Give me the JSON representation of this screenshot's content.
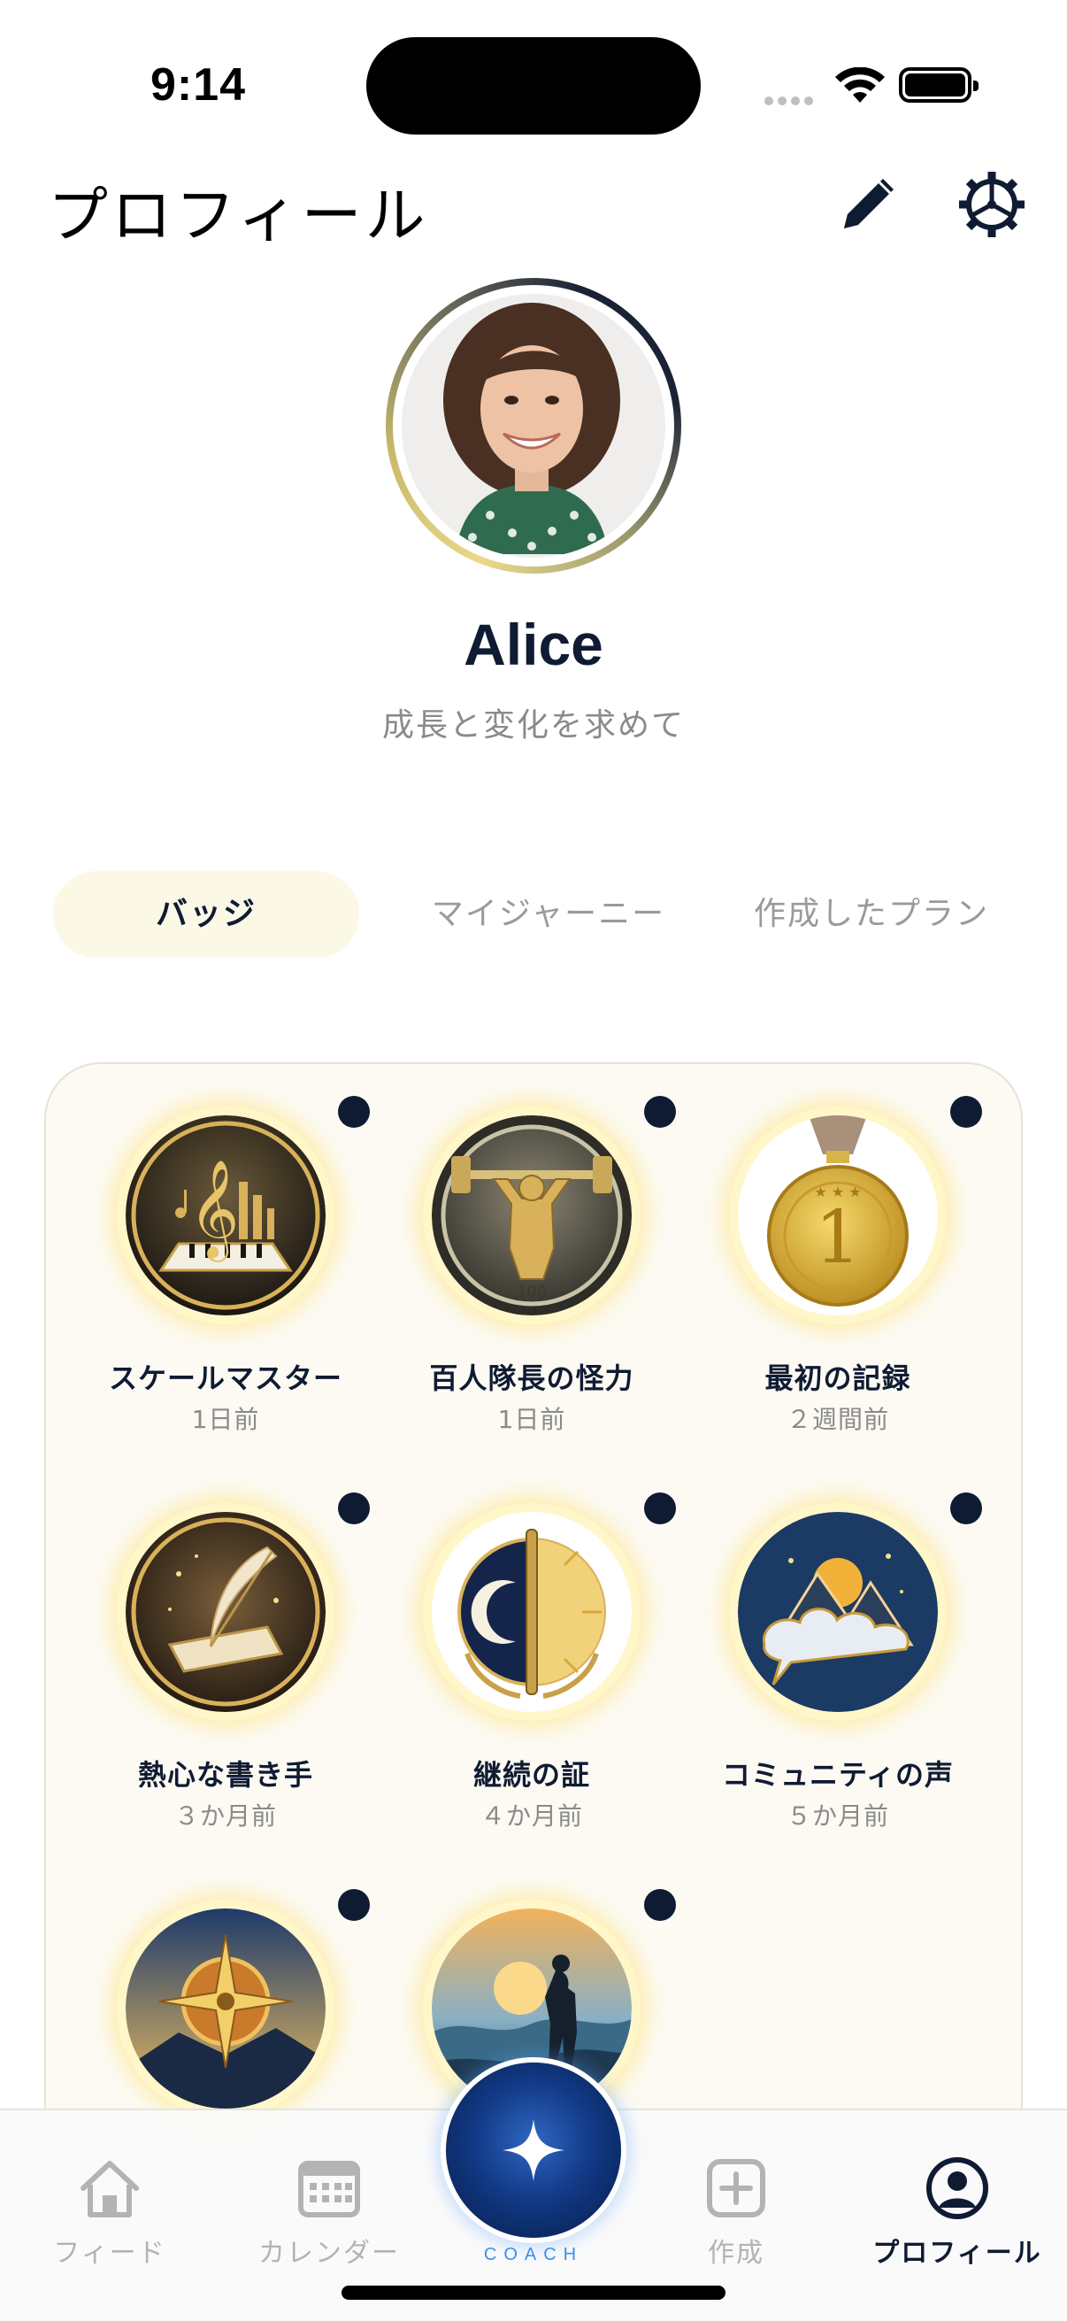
{
  "status_bar": {
    "time": "9:14"
  },
  "header": {
    "title": "プロフィール",
    "edit_icon": "pencil-icon",
    "settings_icon": "gear-icon"
  },
  "profile": {
    "name": "Alice",
    "bio": "成長と変化を求めて"
  },
  "tabs": [
    {
      "label": "バッジ",
      "active": true
    },
    {
      "label": "マイジャーニー",
      "active": false
    },
    {
      "label": "作成したプラン",
      "active": false
    }
  ],
  "badges": [
    {
      "name": "スケールマスター",
      "time": "1日前",
      "icon": "piano-music-medal-icon"
    },
    {
      "name": "百人隊長の怪力",
      "time": "1日前",
      "icon": "weightlifter-100-medal-icon"
    },
    {
      "name": "最初の記録",
      "time": "２週間前",
      "icon": "gold-medal-1-icon"
    },
    {
      "name": "熱心な書き手",
      "time": "３か月前",
      "icon": "quill-scroll-medal-icon"
    },
    {
      "name": "継続の証",
      "time": "４か月前",
      "icon": "moon-sun-pen-medal-icon"
    },
    {
      "name": "コミュニティの声",
      "time": "５か月前",
      "icon": "mountain-speech-bubble-medal-icon"
    },
    {
      "name": "",
      "time": "",
      "icon": "compass-star-medal-icon"
    },
    {
      "name": "",
      "time": "",
      "icon": "hiker-sunset-medal-icon"
    }
  ],
  "bottom_nav": {
    "items": [
      {
        "label": "フィード",
        "icon": "home-icon",
        "active": false
      },
      {
        "label": "カレンダー",
        "icon": "calendar-icon",
        "active": false
      },
      {
        "label": "作成",
        "icon": "plus-square-icon",
        "active": false
      },
      {
        "label": "プロフィール",
        "icon": "person-circle-icon",
        "active": true
      }
    ],
    "coach_label": "COACH",
    "coach_icon": "sparkle-star-icon"
  },
  "colors": {
    "navy": "#0f1b33",
    "gold": "#f5d66b",
    "tab_active_bg": "#fcf8e6",
    "panel_bg": "#fcfaf3",
    "coach_blue": "#3a8ff0"
  }
}
